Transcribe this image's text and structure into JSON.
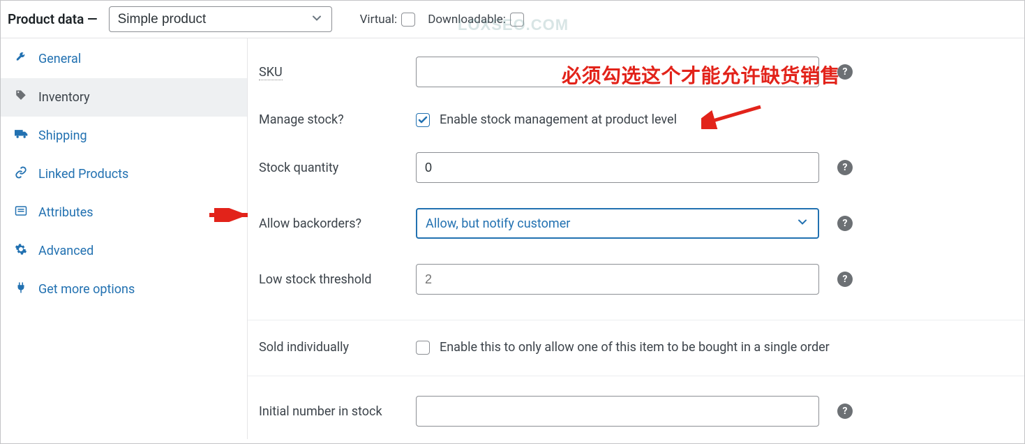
{
  "header": {
    "title": "Product data —",
    "product_type": "Simple product",
    "virtual_label": "Virtual:",
    "downloadable_label": "Downloadable:",
    "virtual_checked": false,
    "downloadable_checked": false,
    "watermark": "LOXSEO.COM"
  },
  "tabs": [
    {
      "icon": "wrench",
      "label": "General",
      "active": false
    },
    {
      "icon": "tag",
      "label": "Inventory",
      "active": true
    },
    {
      "icon": "truck",
      "label": "Shipping",
      "active": false
    },
    {
      "icon": "link",
      "label": "Linked Products",
      "active": false
    },
    {
      "icon": "list",
      "label": "Attributes",
      "active": false
    },
    {
      "icon": "gear",
      "label": "Advanced",
      "active": false
    },
    {
      "icon": "plug",
      "label": "Get more options",
      "active": false
    }
  ],
  "form": {
    "sku": {
      "label": "SKU",
      "value": ""
    },
    "manage_stock": {
      "label": "Manage stock?",
      "checkbox_label": "Enable stock management at product level",
      "checked": true
    },
    "stock_qty": {
      "label": "Stock quantity",
      "value": "0"
    },
    "backorders": {
      "label": "Allow backorders?",
      "value": "Allow, but notify customer"
    },
    "low_stock": {
      "label": "Low stock threshold",
      "placeholder": "2",
      "value": ""
    },
    "sold_indiv": {
      "label": "Sold individually",
      "checkbox_label": "Enable this to only allow one of this item to be bought in a single order",
      "checked": false
    },
    "initial_stock": {
      "label": "Initial number in stock",
      "value": ""
    }
  },
  "annotations": {
    "text1": "必须勾选这个才能允许缺货销售"
  }
}
